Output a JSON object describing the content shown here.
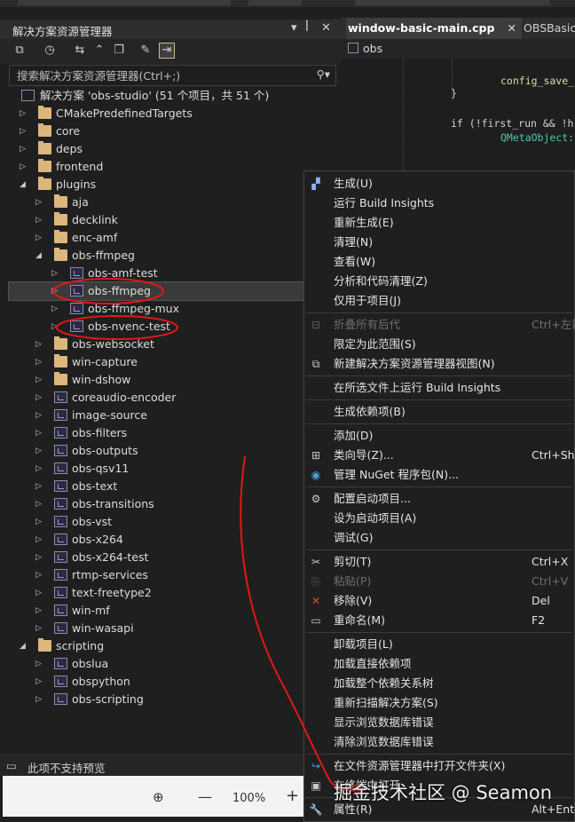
{
  "solution_explorer": {
    "title": "解决方案资源管理器",
    "search_placeholder": "搜索解决方案资源管理器(Ctrl+;)",
    "solution_label": "解决方案 'obs-studio' (51 个项目，共 51 个)",
    "tree": [
      {
        "label": "CMakePredefinedTargets",
        "level": 1,
        "kind": "folder",
        "expanded": false
      },
      {
        "label": "core",
        "level": 1,
        "kind": "folder",
        "expanded": false
      },
      {
        "label": "deps",
        "level": 1,
        "kind": "folder",
        "expanded": false
      },
      {
        "label": "frontend",
        "level": 1,
        "kind": "folder",
        "expanded": false
      },
      {
        "label": "plugins",
        "level": 1,
        "kind": "folder",
        "expanded": true
      },
      {
        "label": "aja",
        "level": 2,
        "kind": "folder",
        "expanded": false
      },
      {
        "label": "decklink",
        "level": 2,
        "kind": "folder",
        "expanded": false
      },
      {
        "label": "enc-amf",
        "level": 2,
        "kind": "folder",
        "expanded": false
      },
      {
        "label": "obs-ffmpeg",
        "level": 2,
        "kind": "folder",
        "expanded": true
      },
      {
        "label": "obs-amf-test",
        "level": 3,
        "kind": "project",
        "expanded": false
      },
      {
        "label": "obs-ffmpeg",
        "level": 3,
        "kind": "project",
        "expanded": false,
        "selected": true
      },
      {
        "label": "obs-ffmpeg-mux",
        "level": 3,
        "kind": "project",
        "expanded": false
      },
      {
        "label": "obs-nvenc-test",
        "level": 3,
        "kind": "project",
        "expanded": false
      },
      {
        "label": "obs-websocket",
        "level": 2,
        "kind": "folder",
        "expanded": false
      },
      {
        "label": "win-capture",
        "level": 2,
        "kind": "folder",
        "expanded": false
      },
      {
        "label": "win-dshow",
        "level": 2,
        "kind": "folder",
        "expanded": false
      },
      {
        "label": "coreaudio-encoder",
        "level": 2,
        "kind": "project",
        "expanded": false
      },
      {
        "label": "image-source",
        "level": 2,
        "kind": "project",
        "expanded": false
      },
      {
        "label": "obs-filters",
        "level": 2,
        "kind": "project",
        "expanded": false
      },
      {
        "label": "obs-outputs",
        "level": 2,
        "kind": "project",
        "expanded": false
      },
      {
        "label": "obs-qsv11",
        "level": 2,
        "kind": "project",
        "expanded": false
      },
      {
        "label": "obs-text",
        "level": 2,
        "kind": "project",
        "expanded": false
      },
      {
        "label": "obs-transitions",
        "level": 2,
        "kind": "project",
        "expanded": false
      },
      {
        "label": "obs-vst",
        "level": 2,
        "kind": "project",
        "expanded": false
      },
      {
        "label": "obs-x264",
        "level": 2,
        "kind": "project",
        "expanded": false
      },
      {
        "label": "obs-x264-test",
        "level": 2,
        "kind": "project",
        "expanded": false
      },
      {
        "label": "rtmp-services",
        "level": 2,
        "kind": "project",
        "expanded": false
      },
      {
        "label": "text-freetype2",
        "level": 2,
        "kind": "project",
        "expanded": false
      },
      {
        "label": "win-mf",
        "level": 2,
        "kind": "project",
        "expanded": false
      },
      {
        "label": "win-wasapi",
        "level": 2,
        "kind": "project",
        "expanded": false
      },
      {
        "label": "scripting",
        "level": 1,
        "kind": "folder",
        "expanded": true
      },
      {
        "label": "obslua",
        "level": 2,
        "kind": "project",
        "expanded": false
      },
      {
        "label": "obspython",
        "level": 2,
        "kind": "project",
        "expanded": false
      },
      {
        "label": "obs-scripting",
        "level": 2,
        "kind": "project",
        "expanded": false
      }
    ],
    "preview_text": "此项不支持预览",
    "zoom": "100%"
  },
  "editor": {
    "active_tab": "window-basic-main.cpp",
    "second_tab": "OBSBasic.",
    "nav_scope": "obs",
    "code": {
      "line1": "config_save_",
      "line2": "}",
      "line3": "if (!first_run && !h",
      "line4": "QMetaObject:"
    }
  },
  "context_menu": {
    "items": [
      {
        "label": "生成(U)",
        "shortcut": "",
        "icon": "build-icon",
        "enabled": true
      },
      {
        "label": "运行 Build Insights",
        "shortcut": "",
        "icon": "",
        "enabled": true
      },
      {
        "label": "重新生成(E)",
        "shortcut": "",
        "icon": "",
        "enabled": true
      },
      {
        "label": "清理(N)",
        "shortcut": "",
        "icon": "",
        "enabled": true
      },
      {
        "label": "查看(W)",
        "shortcut": "",
        "icon": "",
        "enabled": true
      },
      {
        "label": "分析和代码清理(Z)",
        "shortcut": "",
        "icon": "",
        "enabled": true
      },
      {
        "label": "仅用于项目(J)",
        "shortcut": "",
        "icon": "",
        "enabled": true
      },
      {
        "sep": true
      },
      {
        "label": "折叠所有后代",
        "shortcut": "Ctrl+左箭",
        "icon": "collapse-icon",
        "enabled": false
      },
      {
        "label": "限定为此范围(S)",
        "shortcut": "",
        "icon": "",
        "enabled": true
      },
      {
        "label": "新建解决方案资源管理器视图(N)",
        "shortcut": "",
        "icon": "new-view-icon",
        "enabled": true
      },
      {
        "sep": true
      },
      {
        "label": "在所选文件上运行 Build Insights",
        "shortcut": "",
        "icon": "",
        "enabled": true
      },
      {
        "sep": true
      },
      {
        "label": "生成依赖项(B)",
        "shortcut": "",
        "icon": "",
        "enabled": true
      },
      {
        "sep": true
      },
      {
        "label": "添加(D)",
        "shortcut": "",
        "icon": "",
        "enabled": true
      },
      {
        "label": "类向导(Z)...",
        "shortcut": "Ctrl+Shif",
        "icon": "class-wizard-icon",
        "enabled": true
      },
      {
        "label": "管理 NuGet 程序包(N)...",
        "shortcut": "",
        "icon": "nuget-icon",
        "enabled": true
      },
      {
        "sep": true
      },
      {
        "label": "配置启动项目...",
        "shortcut": "",
        "icon": "gear-icon",
        "enabled": true
      },
      {
        "label": "设为启动项目(A)",
        "shortcut": "",
        "icon": "",
        "enabled": true
      },
      {
        "label": "调试(G)",
        "shortcut": "",
        "icon": "",
        "enabled": true
      },
      {
        "sep": true
      },
      {
        "label": "剪切(T)",
        "shortcut": "Ctrl+X",
        "icon": "scissors-icon",
        "enabled": true
      },
      {
        "label": "粘贴(P)",
        "shortcut": "Ctrl+V",
        "icon": "paste-icon",
        "enabled": false
      },
      {
        "label": "移除(V)",
        "shortcut": "Del",
        "icon": "remove-icon",
        "enabled": true
      },
      {
        "label": "重命名(M)",
        "shortcut": "F2",
        "icon": "rename-icon",
        "enabled": true
      },
      {
        "sep": true
      },
      {
        "label": "卸载项目(L)",
        "shortcut": "",
        "icon": "",
        "enabled": true
      },
      {
        "label": "加载直接依赖项",
        "shortcut": "",
        "icon": "",
        "enabled": true
      },
      {
        "label": "加载整个依赖关系树",
        "shortcut": "",
        "icon": "",
        "enabled": true
      },
      {
        "label": "重新扫描解决方案(S)",
        "shortcut": "",
        "icon": "",
        "enabled": true
      },
      {
        "label": "显示浏览数据库错误",
        "shortcut": "",
        "icon": "",
        "enabled": true
      },
      {
        "label": "清除浏览数据库错误",
        "shortcut": "",
        "icon": "",
        "enabled": true
      },
      {
        "sep": true
      },
      {
        "label": "在文件资源管理器中打开文件夹(X)",
        "shortcut": "",
        "icon": "open-folder-icon",
        "enabled": true
      },
      {
        "label": "在终端中打开",
        "shortcut": "",
        "icon": "terminal-icon",
        "enabled": true
      },
      {
        "sep": true
      },
      {
        "label": "属性(R)",
        "shortcut": "Alt+Ente",
        "icon": "wrench-icon",
        "enabled": true
      }
    ]
  },
  "watermark": "掘金技术社区 @ Seamon",
  "colors": {
    "annotation_red": "#e01818",
    "folder": "#dcb67a",
    "accent": "#d7ba7d"
  }
}
